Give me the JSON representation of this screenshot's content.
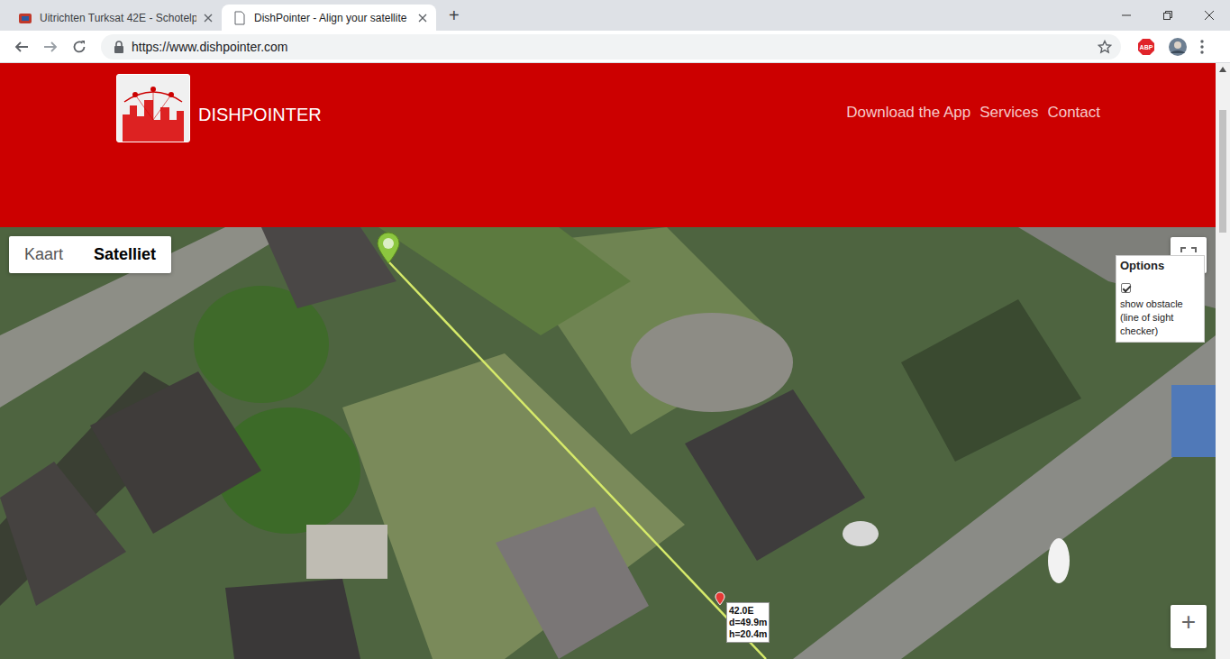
{
  "browser": {
    "tabs": [
      {
        "label": "Uitrichten Turksat 42E - Schotelp",
        "selected": false
      },
      {
        "label": "DishPointer - Align your satellite",
        "selected": true
      }
    ],
    "new_tab": "+",
    "address": "https://www.dishpointer.com",
    "extension_badge": "ABP"
  },
  "header": {
    "brand": "DISHPOINTER",
    "nav": [
      "Download the App",
      "Services",
      "Contact"
    ]
  },
  "map": {
    "type_buttons": [
      {
        "label": "Kaart",
        "selected": false
      },
      {
        "label": "Satelliet",
        "selected": true
      }
    ],
    "options": {
      "title": "Options",
      "show_obstacle": {
        "label": "show obstacle (line of sight checker)",
        "checked": true
      }
    },
    "obstacle": {
      "satellite": "42.0E",
      "distance": "d=49.9m",
      "height": "h=20.4m"
    },
    "zoom_in": "+"
  }
}
